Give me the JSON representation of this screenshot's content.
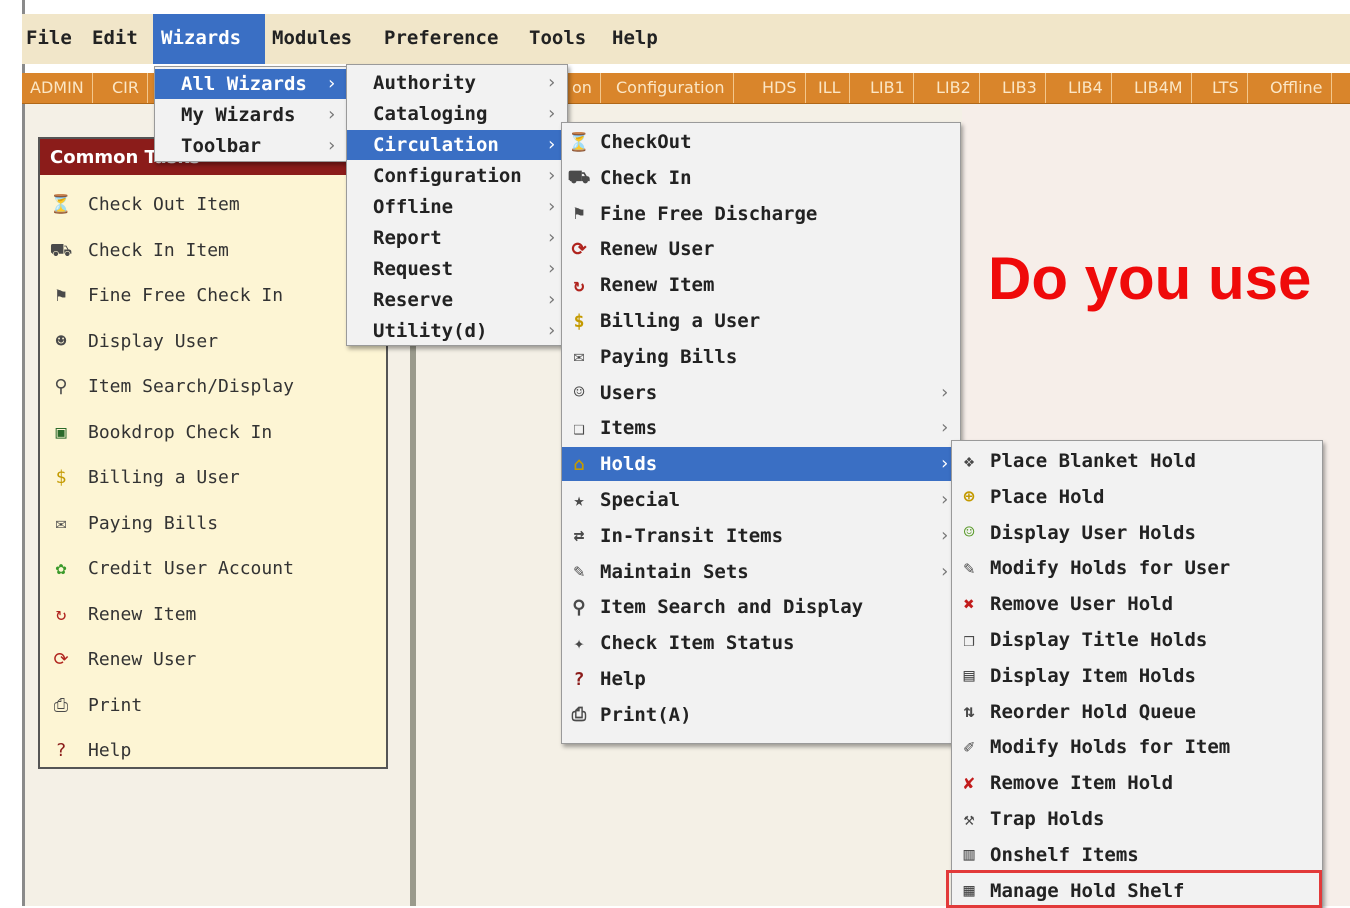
{
  "menubar": {
    "items": [
      "File",
      "Edit",
      "Wizards",
      "Modules",
      "Preference",
      "Tools",
      "Help"
    ],
    "active": "Wizards"
  },
  "tabs": [
    "ADMIN",
    "CIR",
    "on",
    "Configuration",
    "HDS",
    "ILL",
    "LIB1",
    "LIB2",
    "LIB3",
    "LIB4",
    "LIB4M",
    "LTS",
    "Offline"
  ],
  "common_tasks": {
    "title": "Common Tasks",
    "items": [
      {
        "label": "Check Out Item",
        "icon": "checkout-icon"
      },
      {
        "label": "Check In Item",
        "icon": "checkin-icon"
      },
      {
        "label": "Fine Free Check In",
        "icon": "fine-free-icon"
      },
      {
        "label": "Display User",
        "icon": "user-icon"
      },
      {
        "label": "Item Search/Display",
        "icon": "item-search-icon"
      },
      {
        "label": "Bookdrop Check In",
        "icon": "bookdrop-icon"
      },
      {
        "label": "Billing a User",
        "icon": "billing-icon"
      },
      {
        "label": "Paying Bills",
        "icon": "paying-bills-icon"
      },
      {
        "label": "Credit User Account",
        "icon": "credit-icon"
      },
      {
        "label": "Renew Item",
        "icon": "renew-item-icon"
      },
      {
        "label": "Renew User",
        "icon": "renew-user-icon"
      },
      {
        "label": "Print",
        "icon": "printer-icon"
      },
      {
        "label": "Help",
        "icon": "help-icon"
      }
    ]
  },
  "wizards_menu": {
    "items": [
      "All Wizards",
      "My Wizards",
      "Toolbar"
    ],
    "highlighted": "All Wizards"
  },
  "all_wizards_menu": {
    "items": [
      "Authority",
      "Cataloging",
      "Circulation",
      "Configuration",
      "Offline",
      "Report",
      "Request",
      "Reserve",
      "Utility(d)"
    ],
    "highlighted": "Circulation"
  },
  "circulation_menu": {
    "items": [
      {
        "label": "CheckOut",
        "icon": "checkout-icon",
        "submenu": false
      },
      {
        "label": "Check In",
        "icon": "checkin-icon",
        "submenu": false
      },
      {
        "label": "Fine Free Discharge",
        "icon": "fine-free-icon",
        "submenu": false
      },
      {
        "label": "Renew User",
        "icon": "renew-user-icon",
        "submenu": false
      },
      {
        "label": "Renew Item",
        "icon": "renew-item-icon",
        "submenu": false
      },
      {
        "label": "Billing a User",
        "icon": "billing-icon",
        "submenu": false
      },
      {
        "label": "Paying Bills",
        "icon": "paying-bills-icon",
        "submenu": false
      },
      {
        "label": "Users",
        "icon": "users-icon",
        "submenu": true
      },
      {
        "label": "Items",
        "icon": "items-icon",
        "submenu": true
      },
      {
        "label": "Holds",
        "icon": "holds-icon",
        "submenu": true
      },
      {
        "label": "Special",
        "icon": "special-icon",
        "submenu": true
      },
      {
        "label": "In-Transit Items",
        "icon": "in-transit-icon",
        "submenu": true
      },
      {
        "label": "Maintain Sets",
        "icon": "maintain-sets-icon",
        "submenu": true
      },
      {
        "label": "Item Search and Display",
        "icon": "item-search-icon",
        "submenu": false
      },
      {
        "label": "Check Item Status",
        "icon": "item-status-icon",
        "submenu": false
      },
      {
        "label": "Help",
        "icon": "help-icon",
        "submenu": false
      },
      {
        "label": "Print(A)",
        "icon": "printer-icon",
        "submenu": false
      }
    ],
    "highlighted": "Holds"
  },
  "holds_menu": {
    "items": [
      {
        "label": "Place Blanket Hold",
        "icon": "blanket-hold-icon"
      },
      {
        "label": "Place Hold",
        "icon": "place-hold-icon"
      },
      {
        "label": "Display User Holds",
        "icon": "user-holds-icon"
      },
      {
        "label": "Modify Holds for User",
        "icon": "modify-user-holds-icon"
      },
      {
        "label": "Remove User Hold",
        "icon": "remove-user-hold-icon"
      },
      {
        "label": "Display Title Holds",
        "icon": "title-holds-icon"
      },
      {
        "label": "Display Item Holds",
        "icon": "item-holds-icon"
      },
      {
        "label": "Reorder Hold Queue",
        "icon": "reorder-icon"
      },
      {
        "label": "Modify Holds for Item",
        "icon": "modify-item-holds-icon"
      },
      {
        "label": "Remove Item Hold",
        "icon": "remove-item-hold-icon"
      },
      {
        "label": "Trap Holds",
        "icon": "trap-holds-icon"
      },
      {
        "label": "Onshelf Items",
        "icon": "onshelf-icon"
      },
      {
        "label": "Manage Hold Shelf",
        "icon": "hold-shelf-icon"
      }
    ],
    "boxed": "Manage Hold Shelf"
  },
  "overlay": {
    "text": "Do you use"
  }
}
